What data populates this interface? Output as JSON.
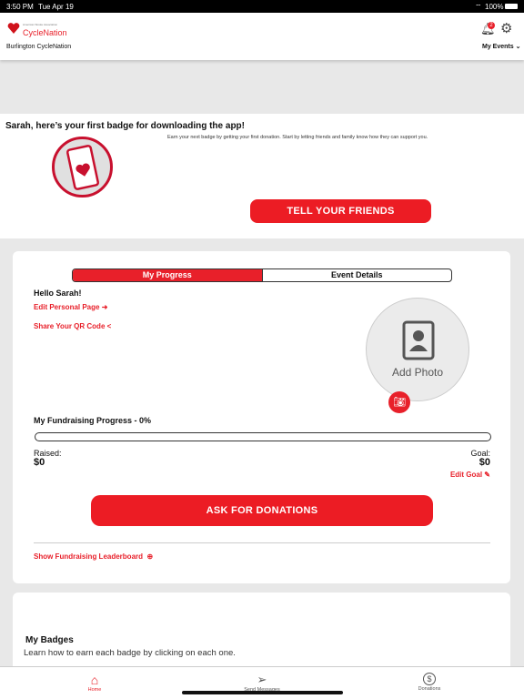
{
  "status": {
    "time": "3:50 PM",
    "date": "Tue Apr 19",
    "battery": "100%"
  },
  "header": {
    "logo_org": "American Stroke Association",
    "logo_name": "CycleNation",
    "event": "Burlington CycleNation",
    "notifications": "2",
    "my_events": "My Events"
  },
  "banner": {
    "title": "Sarah, here’s your first badge for downloading the app!",
    "text": "Earn your next badge by getting your first donation. Start by letting friends and family know how they can support you.",
    "button": "TELL YOUR FRIENDS"
  },
  "progress": {
    "tabs": [
      "My Progress",
      "Event Details"
    ],
    "hello": "Hello Sarah!",
    "edit_page": "Edit Personal Page",
    "share_qr": "Share Your QR Code",
    "add_photo": "Add Photo",
    "fund_title": "My Fundraising Progress - 0%",
    "percent": 0,
    "raised_label": "Raised:",
    "raised": "$0",
    "goal_label": "Goal:",
    "goal": "$0",
    "edit_goal": "Edit Goal",
    "ask": "ASK FOR DONATIONS",
    "leaderboard": "Show Fundraising Leaderboard"
  },
  "badges": {
    "title": "My Badges",
    "subtitle": "Learn how to earn each badge by clicking on each one."
  },
  "tabbar": {
    "items": [
      "Home",
      "Send Messages",
      "Donations"
    ]
  },
  "colors": {
    "accent": "#ec1c24"
  }
}
